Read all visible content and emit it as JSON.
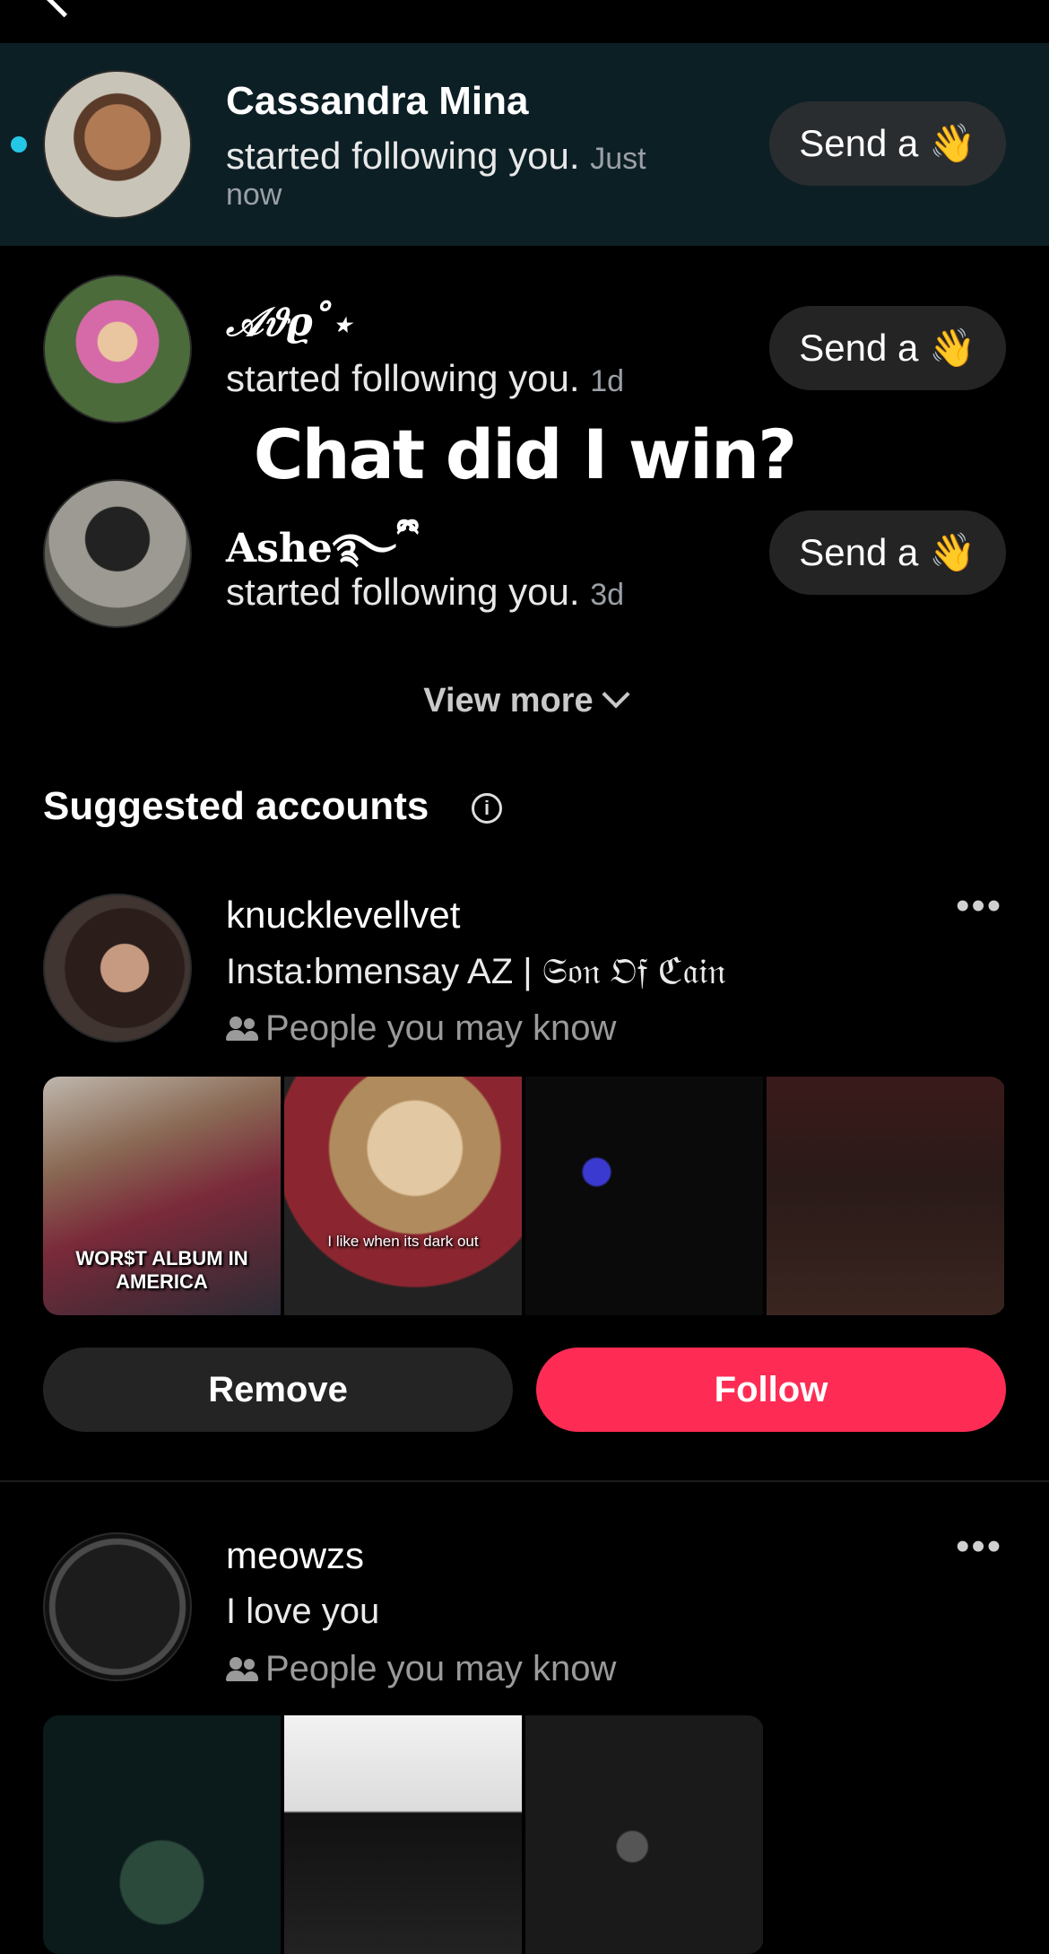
{
  "notifications": [
    {
      "name": "Cassandra Mina",
      "action": "started following you.",
      "time": "Just",
      "time2": "now",
      "button": "Send a",
      "wave": "👋"
    },
    {
      "name": "𝒜𝜗ϱ˚⋆",
      "action": "started following you.",
      "time": "1d",
      "button": "Send a",
      "wave": "👋"
    },
    {
      "name": "Ashe࿐ྀི",
      "action": "started following you.",
      "time": "3d",
      "button": "Send a",
      "wave": "👋"
    }
  ],
  "overlay_caption": "Chat did I win?",
  "view_more": "View more",
  "suggested": {
    "title": "Suggested accounts",
    "info_icon": "ⓘ",
    "more": "•••",
    "accounts": [
      {
        "username": "knucklevellvet",
        "bio": "Insta:bmensay AZ | 𝔖𝔬𝔫 𝔒𝔣 ℭ𝔞𝔦𝔫",
        "reason": "People you may know",
        "thumb_captions": [
          "WOR$T ALBUM IN AMERICA",
          "I like when its dark out"
        ],
        "remove": "Remove",
        "follow": "Follow"
      },
      {
        "username": "meowzs",
        "bio": "I love you",
        "reason": "People you may know"
      }
    ]
  },
  "colors": {
    "follow": "#fe2c55",
    "unread_dot": "#25c7e6",
    "highlight_row": "#0c1f25"
  }
}
